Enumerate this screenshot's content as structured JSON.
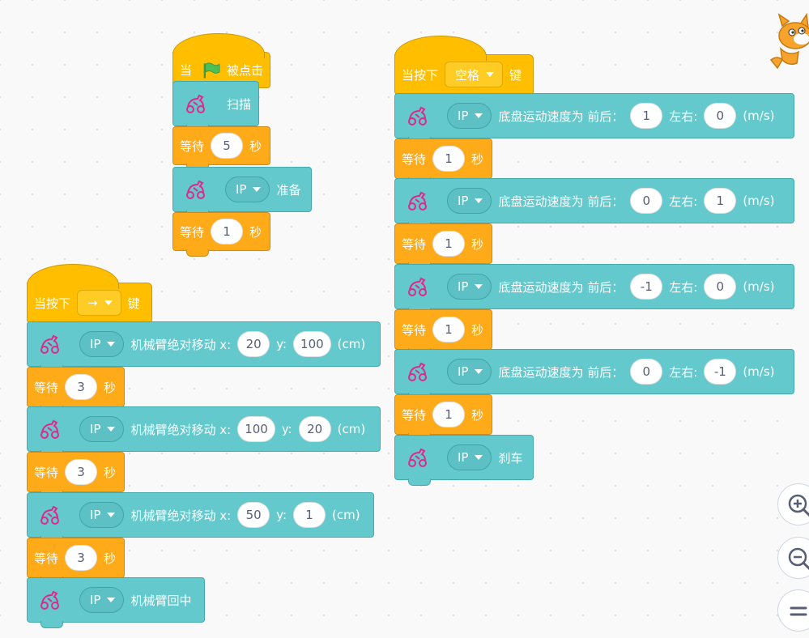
{
  "labels": {
    "when": "当",
    "flag_clicked": "被点击",
    "when_key_pressed": "当按下",
    "key_word": "键",
    "wait": "等待",
    "seconds": "秒",
    "scan": "扫描",
    "prepare": "准备",
    "arm_move_abs": "机械臂绝对移动 x:",
    "y": "y:",
    "cm": "(cm)",
    "arm_center": "机械臂回中",
    "chassis_speed": "底盘运动速度为 前后：",
    "left_right": "左右:",
    "ms": "(m/s)",
    "brake": "刹车",
    "ip": "IP"
  },
  "script_flag": {
    "wait1": "5",
    "wait2": "1"
  },
  "script_space": {
    "key": "空格",
    "moves": [
      {
        "fb": "1",
        "lr": "0"
      },
      {
        "fb": "0",
        "lr": "1"
      },
      {
        "fb": "-1",
        "lr": "0"
      },
      {
        "fb": "0",
        "lr": "-1"
      }
    ],
    "waits": [
      "1",
      "1",
      "1",
      "1"
    ]
  },
  "script_arrow": {
    "key": "→",
    "arm_moves": [
      {
        "x": "20",
        "y": "100"
      },
      {
        "x": "100",
        "y": "20"
      },
      {
        "x": "50",
        "y": "1"
      }
    ],
    "waits": [
      "3",
      "3",
      "3"
    ]
  },
  "colors": {
    "event": "#ffbf00",
    "control": "#ffab19",
    "extension": "#63c9cd"
  },
  "icons": {
    "robot": "robot-icon",
    "flag": "green-flag-icon",
    "zoom_in": "zoom-in-icon",
    "zoom_out": "zoom-out-icon",
    "reset": "zoom-reset-icon"
  }
}
